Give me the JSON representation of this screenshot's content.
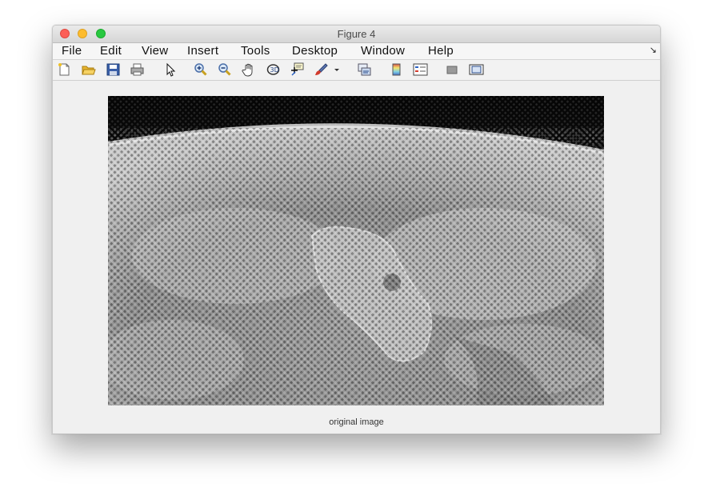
{
  "window": {
    "title": "Figure 4"
  },
  "menubar": {
    "items": [
      "File",
      "Edit",
      "View",
      "Insert",
      "Tools",
      "Desktop",
      "Window",
      "Help"
    ],
    "overflow_icon": "arrow-icon"
  },
  "toolbar": {
    "buttons": [
      "new-figure-icon",
      "open-file-icon",
      "save-icon",
      "print-icon",
      "pointer-icon",
      "zoom-in-icon",
      "zoom-out-icon",
      "pan-icon",
      "rotate-3d-icon",
      "data-cursor-icon",
      "brush-icon",
      "brush-dropdown-icon",
      "link-plot-icon",
      "colorbar-icon",
      "legend-icon",
      "hide-plot-tools-icon",
      "show-plot-tools-icon"
    ]
  },
  "figure": {
    "xlabel": "original image"
  },
  "colors": {
    "close": "#fc5f57",
    "minimize": "#fdbc2e",
    "maximize": "#28c840"
  }
}
